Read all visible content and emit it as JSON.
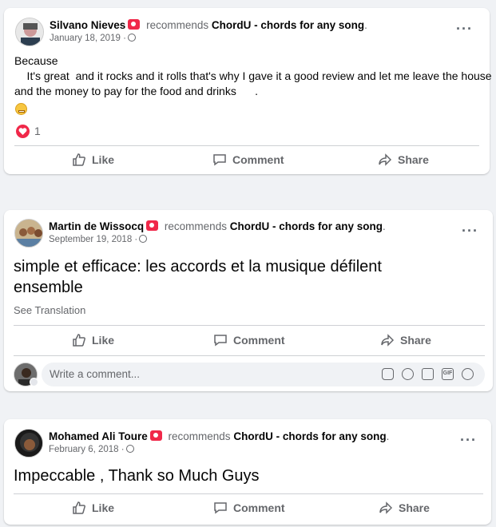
{
  "colors": {
    "reaction_red": "#f02849",
    "muted": "#65676b",
    "bg": "#f0f2f5"
  },
  "posts": [
    {
      "author": "Silvano Nieves",
      "recommends": "recommends",
      "app": "ChordU - chords for any song",
      "date": "January 18, 2019 ·",
      "text_lines": [
        "Because",
        "    It's great  and it rocks and it rolls that's why I gave it a good review and let me leave the house",
        "and the money to pay for the food and drinks      ."
      ],
      "emoji": "grimacing-face-emoji",
      "reaction_count": "1",
      "actions": {
        "like": "Like",
        "comment": "Comment",
        "share": "Share"
      }
    },
    {
      "author": "Martin de Wissocq",
      "recommends": "recommends",
      "app": "ChordU - chords for any song",
      "date": "September 19, 2018 ·",
      "text_lines": [
        "simple et efficace: les accords et la musique défilent",
        "ensemble"
      ],
      "see_translation": "See Translation",
      "actions": {
        "like": "Like",
        "comment": "Comment",
        "share": "Share"
      },
      "comment_placeholder": "Write a comment..."
    },
    {
      "author": "Mohamed Ali Toure",
      "recommends": "recommends",
      "app": "ChordU - chords for any song",
      "date": "February 6, 2018 ·",
      "text_lines": [
        "Impeccable , Thank so Much Guys"
      ],
      "actions": {
        "like": "Like",
        "comment": "Comment",
        "share": "Share"
      }
    }
  ]
}
